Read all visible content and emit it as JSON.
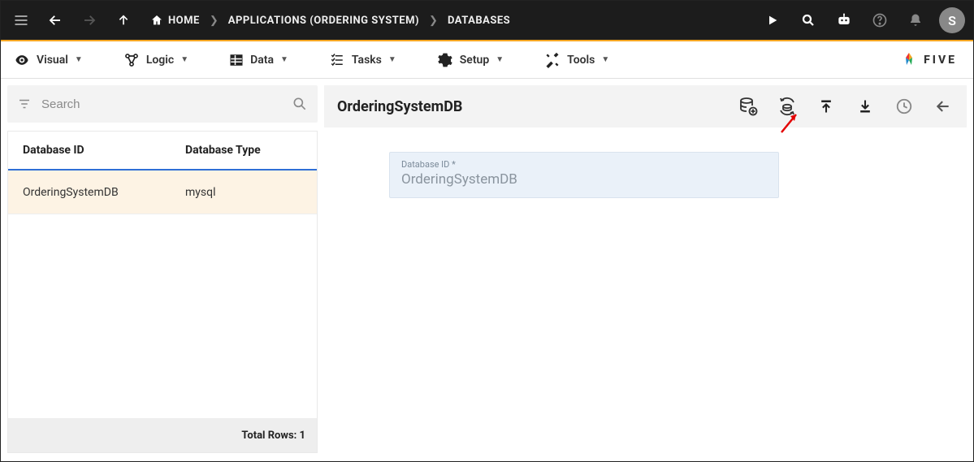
{
  "topbar": {
    "breadcrumbs": [
      "HOME",
      "APPLICATIONS (ORDERING SYSTEM)",
      "DATABASES"
    ],
    "avatar_initial": "S"
  },
  "menu": {
    "items": [
      {
        "label": "Visual"
      },
      {
        "label": "Logic"
      },
      {
        "label": "Data"
      },
      {
        "label": "Tasks"
      },
      {
        "label": "Setup"
      },
      {
        "label": "Tools"
      }
    ],
    "brand": "FIVE"
  },
  "left": {
    "search_placeholder": "Search",
    "columns": [
      "Database ID",
      "Database Type"
    ],
    "rows": [
      {
        "id": "OrderingSystemDB",
        "type": "mysql"
      }
    ],
    "footer_label": "Total Rows:",
    "footer_count": "1"
  },
  "detail": {
    "title": "OrderingSystemDB",
    "field_label": "Database ID *",
    "field_value": "OrderingSystemDB"
  }
}
